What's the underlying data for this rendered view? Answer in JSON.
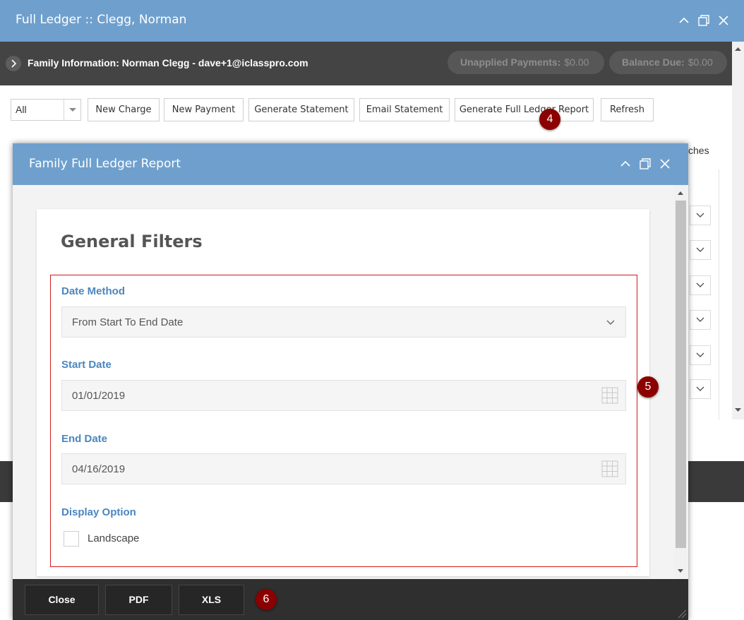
{
  "outer_window": {
    "title": "Full Ledger :: Clegg, Norman"
  },
  "family_bar": {
    "text": "Family Information: Norman Clegg - dave+1@iclasspro.com",
    "unapplied_label": "Unapplied Payments:",
    "unapplied_value": "$0.00",
    "balance_label": "Balance Due:",
    "balance_value": "$0.00"
  },
  "toolbar": {
    "filter_value": "All",
    "buttons": [
      "New Charge",
      "New Payment",
      "Generate Statement",
      "Email Statement",
      "Generate Full Ledger Report",
      "Refresh"
    ]
  },
  "background_peek_text": "ches",
  "markers": [
    "4",
    "5",
    "6"
  ],
  "dialog": {
    "title": "Family Full Ledger Report",
    "heading": "General Filters",
    "date_method_label": "Date Method",
    "date_method_value": "From Start To End Date",
    "start_date_label": "Start Date",
    "start_date_value": "01/01/2019",
    "end_date_label": "End Date",
    "end_date_value": "04/16/2019",
    "display_option_label": "Display Option",
    "landscape_label": "Landscape",
    "landscape_checked": false,
    "footer_buttons": [
      "Close",
      "PDF",
      "XLS"
    ]
  },
  "colors": {
    "titlebar": "#6fa0cd",
    "family_bar": "#444444",
    "label_blue": "#4a86c0",
    "highlight_red": "#d11a1a",
    "marker": "#8b0000",
    "footer": "#2f2f2f"
  }
}
